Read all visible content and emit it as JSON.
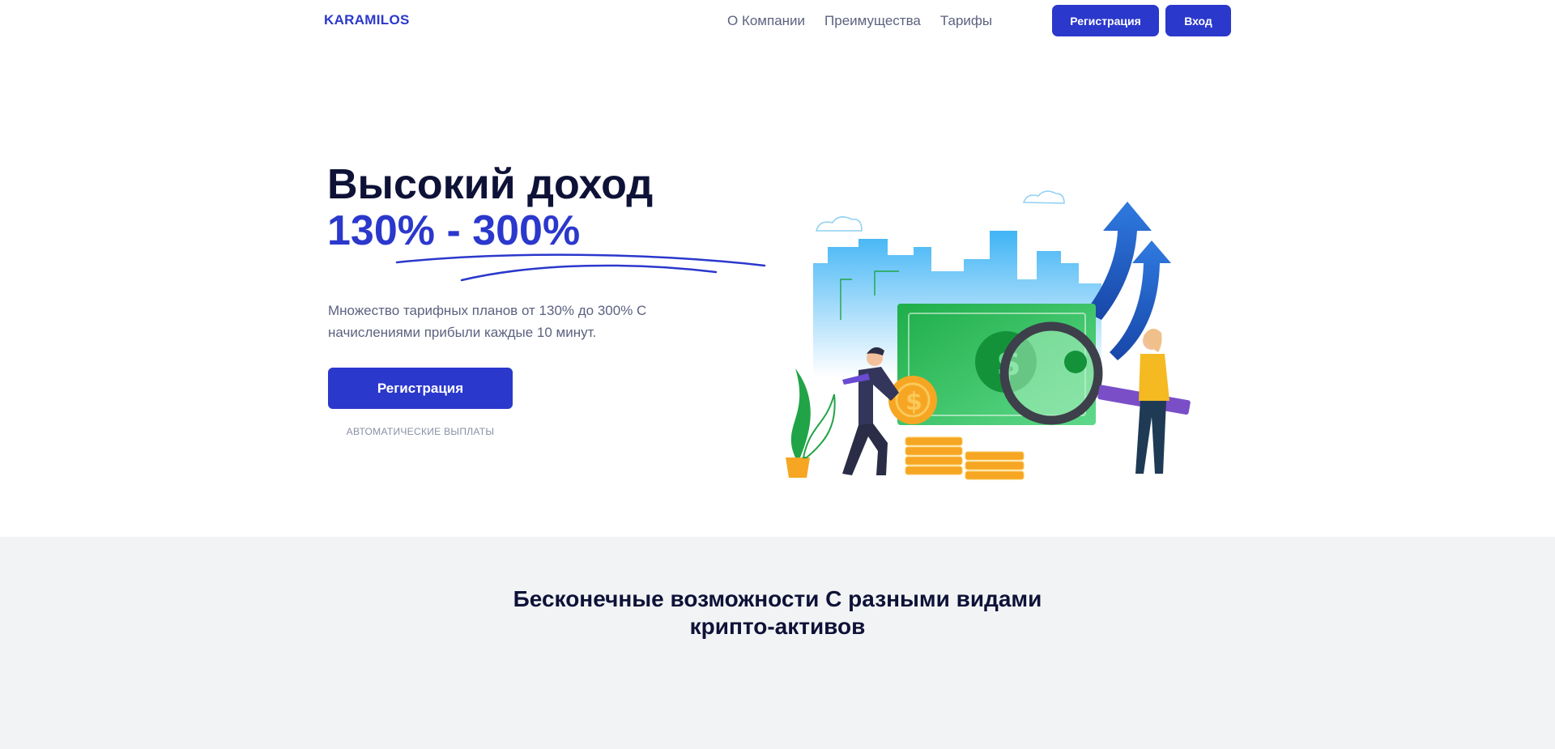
{
  "header": {
    "logo": "KARAMILOS",
    "nav": [
      "О Компании",
      "Преимущества",
      "Тарифы"
    ],
    "register_label": "Регистрация",
    "login_label": "Вход"
  },
  "hero": {
    "title": "Высокий доход",
    "subtitle": "130% - 300%",
    "description": "Множество тарифных планов от 130% до 300% С начислениями прибыли каждые 10 минут.",
    "cta_label": "Регистрация",
    "note": "АВТОМАТИЧЕСКИЕ ВЫПЛАТЫ"
  },
  "features": {
    "title_line1": "Бесконечные возможности С разными видами",
    "title_line2": "крипто-активов"
  },
  "colors": {
    "accent": "#2b38cc",
    "heading": "#0e1237",
    "muted": "#5c6280",
    "band_bg": "#f2f3f5"
  }
}
